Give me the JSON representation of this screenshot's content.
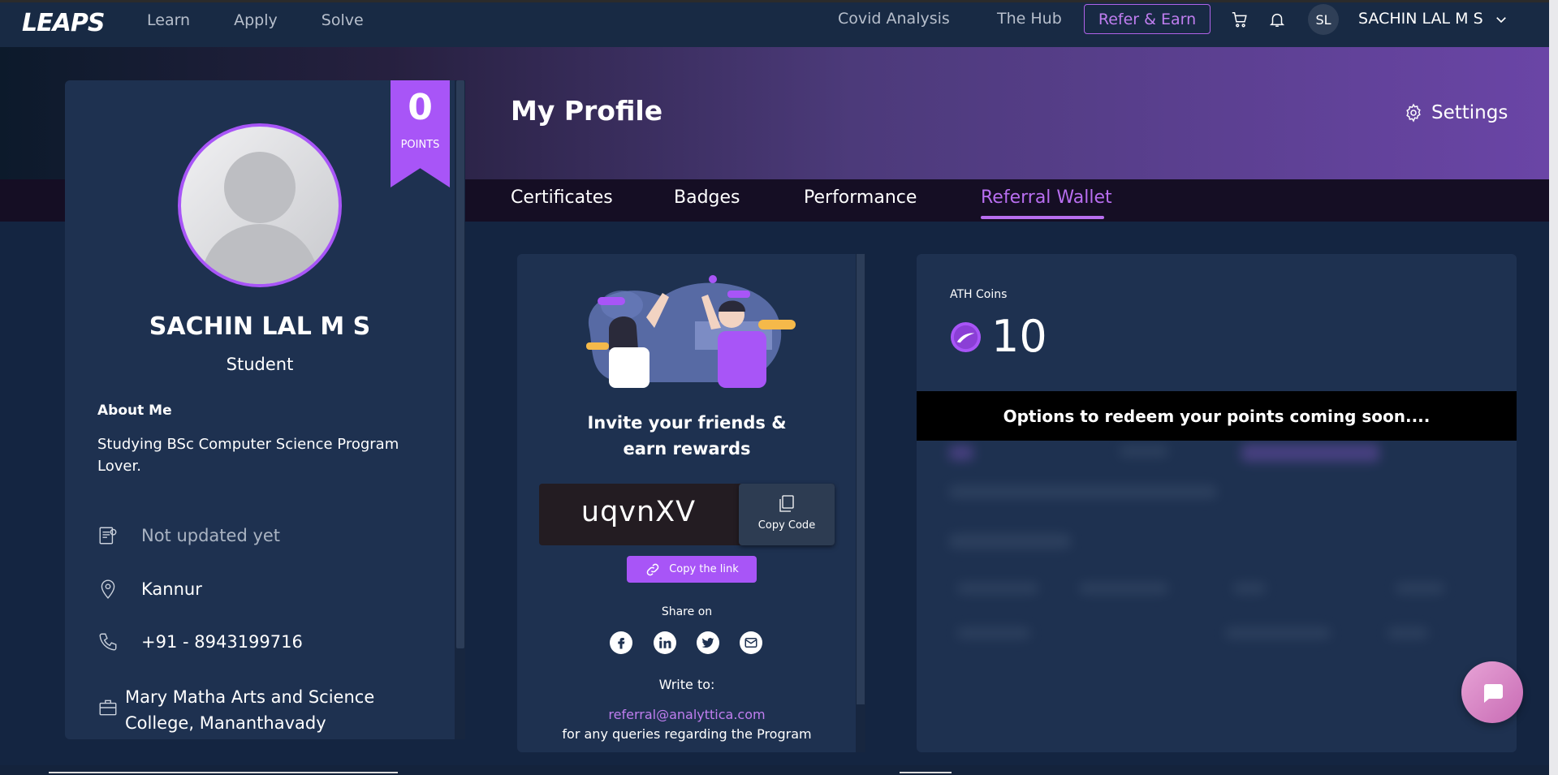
{
  "nav": {
    "logo": "LEAPS",
    "links": [
      "Learn",
      "Apply",
      "Solve"
    ],
    "covid": "Covid Analysis",
    "hub": "The Hub",
    "refer": "Refer & Earn",
    "avatar_initials": "SL",
    "user_name": "SACHIN LAL M S"
  },
  "header": {
    "title": "My Profile",
    "settings": "Settings"
  },
  "tabs": [
    {
      "label": "Certificates"
    },
    {
      "label": "Badges"
    },
    {
      "label": "Performance"
    },
    {
      "label": "Referral Wallet",
      "active": true
    }
  ],
  "profile": {
    "points": "0",
    "points_label": "POINTS",
    "name": "SACHIN LAL M S",
    "role": "Student",
    "about_heading": "About Me",
    "about_text": "Studying BSc Computer Science Program Lover.",
    "dob": "Not updated yet",
    "location": "Kannur",
    "phone": "+91 - 8943199716",
    "college": "Mary Matha Arts and Science College, Mananthavady"
  },
  "referral": {
    "invite": "Invite your friends & earn rewards",
    "code": "uqvnXV",
    "copy_code": "Copy Code",
    "copy_link": "Copy the link",
    "share_on": "Share on",
    "write_to": "Write to:",
    "email": "referral@analyttica.com",
    "note": "for any queries regarding the Program",
    "social": [
      "facebook-icon",
      "linkedin-icon",
      "twitter-icon",
      "mail-icon"
    ]
  },
  "coins": {
    "label": "ATH Coins",
    "value": "10",
    "redeem": "Options to redeem your points coming soon...."
  },
  "colors": {
    "accent": "#a855f7",
    "card": "#1e3150",
    "background": "#142541"
  }
}
